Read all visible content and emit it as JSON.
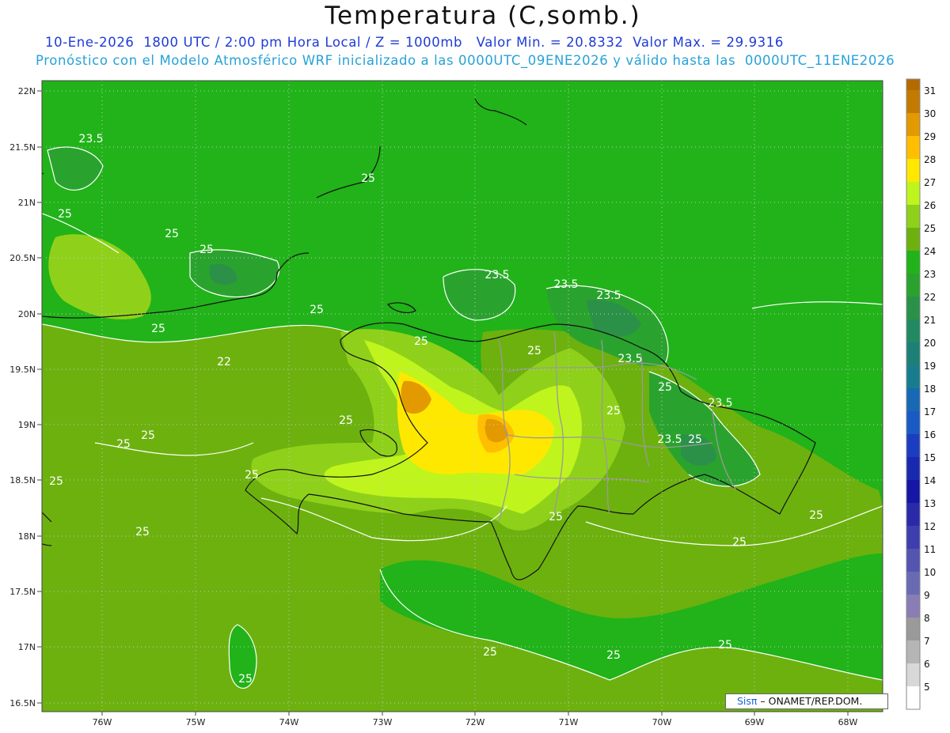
{
  "header": {
    "title": "Temperatura (C,somb.)",
    "line1": "10-Ene-2026  1800 UTC / 2:00 pm Hora Local / Z = 1000mb   Valor Min. = 20.8332  Valor Max. = 29.9316",
    "line2": "Pronóstico con el Modelo Atmosférico WRF inicializado a las 0000UTC_09ENE2026 y válido hasta las  0000UTC_11ENE2026"
  },
  "axes": {
    "lat_labels": [
      "22N",
      "21.5N",
      "21N",
      "20.5N",
      "20N",
      "19.5N",
      "19N",
      "18.5N",
      "18N",
      "17.5N",
      "17N",
      "16.5N"
    ],
    "lon_labels": [
      "76W",
      "75W",
      "74W",
      "73W",
      "72W",
      "71W",
      "70W",
      "69W",
      "68W"
    ]
  },
  "colorbar": {
    "labels": [
      "31",
      "30",
      "29",
      "28",
      "27",
      "26",
      "25",
      "24",
      "23",
      "22",
      "21",
      "20",
      "19",
      "18",
      "17",
      "16",
      "15",
      "14",
      "13",
      "12",
      "11",
      "10",
      "9",
      "8",
      "7",
      "6",
      "5"
    ],
    "colors": [
      "#c47a00",
      "#e39a00",
      "#ffbf00",
      "#ffe800",
      "#bff51c",
      "#8fd11a",
      "#6db10f",
      "#21b319",
      "#2aa32e",
      "#2b9148",
      "#218a62",
      "#1d8076",
      "#177d8e",
      "#1769b4",
      "#1a5ac4",
      "#1c3dc2",
      "#1829b0",
      "#1515a6",
      "#2a2aa8",
      "#3e3eae",
      "#5454b1",
      "#6a6ab4",
      "#8a7db4",
      "#9a9a9a",
      "#b5b5b5",
      "#d8d8d8",
      "#ffffff"
    ]
  },
  "contour_labels": [
    "23.5",
    "25",
    "25",
    "25",
    "23.5",
    "25",
    "25",
    "25",
    "23.5",
    "23.5",
    "22",
    "25",
    "25",
    "23.5",
    "25",
    "23.5",
    "25",
    "25",
    "25",
    "25",
    "25",
    "23.5",
    "25",
    "25",
    "25",
    "25",
    "25",
    "25",
    "25",
    "25",
    "25",
    "25"
  ],
  "credit": {
    "brand": "Sisπ",
    "rest": " – ONAMET/REP.DOM."
  }
}
